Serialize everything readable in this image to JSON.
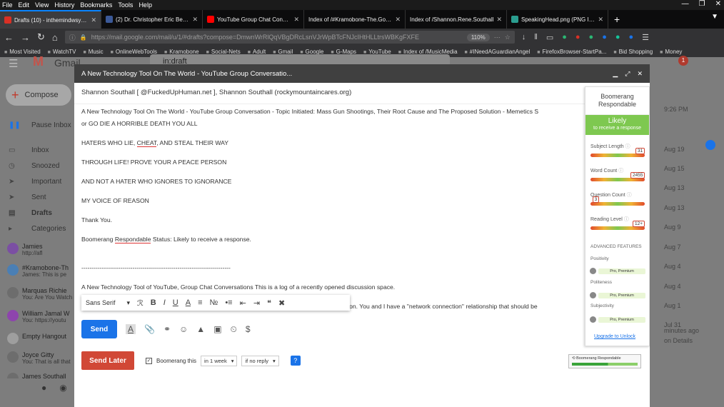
{
  "menubar": {
    "items": [
      "File",
      "Edit",
      "View",
      "History",
      "Bookmarks",
      "Tools",
      "Help"
    ]
  },
  "tabs": [
    {
      "label": "Drafts (10) - inthemindwsy@g...",
      "color": "#d93025"
    },
    {
      "label": "(2) Dr. Christopher Eric Berger...",
      "color": "#3b5998"
    },
    {
      "label": "YouTube Group Chat Conversa...",
      "color": "#ff0000"
    },
    {
      "label": "Index of /#Kramobone-The.Good..",
      "color": "#555"
    },
    {
      "label": "Index of /Shannon.Rene.Southall",
      "color": "#555"
    },
    {
      "label": "SpeakingHead.png (PNG Imag...",
      "color": "#2a9d8f"
    }
  ],
  "nav": {
    "url": "https://mail.google.com/mail/u/1/#drafts?compose=DmwnWrRlQqVBgDRcLsnVJrWpBTcFNJcIHtHLLtrsWBKgFXFE",
    "zoom": "110%"
  },
  "bookmarks": [
    "Most Visited",
    "WatchTV",
    "Music",
    "OnlineWebTools",
    "Kramobone",
    "Social-Nets",
    "Adult",
    "Gmail",
    "Google",
    "G-Maps",
    "YouTube",
    "Index of /MusicMedia",
    "#INeedAGuardianAngel",
    "FirefoxBrowser-StartPa...",
    "Bid Shopping",
    "Money"
  ],
  "gmail": {
    "search": "in:draft",
    "compose": "Compose",
    "sidebar": [
      "Pause Inbox",
      "Inbox",
      "Snoozed",
      "Important",
      "Sent",
      "Drafts",
      "Categories"
    ],
    "chats": [
      {
        "name": "Jamies",
        "line": "http://afl",
        "color": "#7b4fa3"
      },
      {
        "name": "#Kramobone-Th",
        "line": "James: This is pe",
        "color": "#4a7fb5"
      },
      {
        "name": "Marquas Richie",
        "line": "You: Are You Watch",
        "color": "#6d6d6d"
      },
      {
        "name": "William Jamal W",
        "line": "You: https://youtu",
        "color": "#8e44ad"
      },
      {
        "name": "Empty Hangout",
        "line": "",
        "color": "#9e9e9e"
      },
      {
        "name": "Joyce Gitty",
        "line": "You: That is all that",
        "color": "#6d6d6d"
      },
      {
        "name": "James Southall",
        "line": "",
        "color": "#6d6d6d"
      }
    ],
    "dates": [
      "9:26 PM",
      "Aug 19",
      "Aug 15",
      "Aug 13",
      "Aug 13",
      "Aug 9",
      "Aug 7",
      "Aug 4",
      "Aug 4",
      "Aug 1",
      "Jul 31",
      "minutes ago",
      "on   Details"
    ]
  },
  "compose": {
    "title": "A New Technology Tool On The World - YouTube Group Conversatio...",
    "recipients": "Shannon Southall [ @FuckedUpHuman.net ], Shannon Southall (rockymountaincares.org)",
    "body": {
      "l1": "A New Technology Tool On The World - YouTube Group Conversation - Topic Initiated: Mass Gun Shootings, Their Root Cause and The Proposed Solution - Memetics S",
      "l2": "or GO DIE A HORRIBLE DEATH YOU ALL",
      "l3a": "HATERS WHO LIE, ",
      "l3b": "CHEAT",
      "l3c": ", AND STEAL THEIR WAY",
      "l4": "THROUGH LIFE!  PROVE YOUR A PEACE PERSON",
      "l5": "AND NOT A HATER WHO IGNORES TO IGNORANCE",
      "l6": "MY VOICE OF REASON",
      "l7": "Thank You.",
      "l8a": "Boomerang ",
      "l8b": "Respondable",
      "l8c": " Status: Likely to receive a response.",
      "l9": "-------------------------------------------------------------------------",
      "l10a": "A New Technology Tool of YouTube, Group Chat Conversations ",
      "l10b": "   ",
      "l10c": " This is a log of a recently opened discussion space.",
      "l11": "ation.  You and I have a \"network connection\" relationship that should be"
    },
    "font": "Sans Serif",
    "send": "Send",
    "send_later": "Send Later",
    "boomerang_this": "Boomerang this",
    "when": "in 1 week",
    "cond": "if no reply"
  },
  "boomerang": {
    "title": "Boomerang",
    "subtitle": "Respondable",
    "likely": "Likely",
    "likely_sub": "to receive a response",
    "subject_label": "Subject Length",
    "subject_value": "31",
    "subject_pos": 0.93,
    "word_label": "Word Count",
    "word_value": "2455",
    "word_pos": 0.97,
    "question_label": "Question Count",
    "question_value": "3",
    "question_pos": 0.1,
    "reading_label": "Reading Level",
    "reading_value": "12+",
    "reading_pos": 0.96,
    "advanced": "ADVANCED FEATURES",
    "positivity": "Positivity",
    "politeness": "Politeness",
    "subjectivity": "Subjectivity",
    "pro": "Pro, Premium",
    "upgrade": "Upgrade to Unlock",
    "widget": "Boomerang Respondable"
  }
}
